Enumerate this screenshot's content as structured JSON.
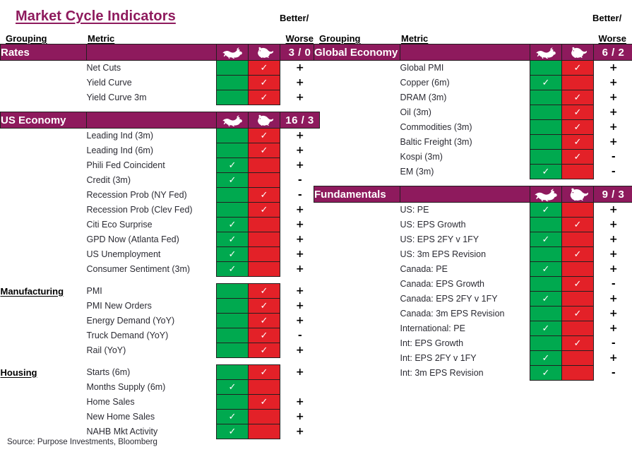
{
  "title": "Market Cycle Indicators",
  "source": "Source: Purpose Investments, Bloomberg",
  "colors": {
    "purple": "#8E1A5D",
    "green": "#00A94F",
    "red": "#E32128",
    "ink": "#231f20"
  },
  "headers": {
    "grouping": "Grouping",
    "metric": "Metric",
    "better": "Better/",
    "worse": "Worse"
  },
  "icons": {
    "bull": "bull-icon",
    "bear": "bear-icon",
    "check": "check-icon"
  },
  "left": {
    "sections": [
      {
        "name": "Rates",
        "score": "3 / 0",
        "has_header": true,
        "rows": [
          {
            "metric": "Net Cuts",
            "bull": "",
            "bear": "✓",
            "trend": "+"
          },
          {
            "metric": "Yield Curve",
            "bull": "",
            "bear": "✓",
            "trend": "+"
          },
          {
            "metric": "Yield Curve 3m",
            "bull": "",
            "bear": "✓",
            "trend": "+"
          }
        ]
      },
      {
        "name": "US Economy",
        "score": "16 / 3",
        "has_header": true,
        "rows": [
          {
            "metric": "Leading Ind (3m)",
            "bull": "",
            "bear": "✓",
            "trend": "+"
          },
          {
            "metric": "Leading Ind (6m)",
            "bull": "",
            "bear": "✓",
            "trend": "+"
          },
          {
            "metric": "Phili Fed Coincident",
            "bull": "✓",
            "bear": "",
            "trend": "+"
          },
          {
            "metric": "Credit (3m)",
            "bull": "✓",
            "bear": "",
            "trend": "-"
          },
          {
            "metric": "Recession Prob (NY Fed)",
            "bull": "",
            "bear": "✓",
            "trend": "-"
          },
          {
            "metric": "Recession Prob (Clev Fed)",
            "bull": "",
            "bear": "✓",
            "trend": "+"
          },
          {
            "metric": "Citi Eco Surprise",
            "bull": "✓",
            "bear": "",
            "trend": "+"
          },
          {
            "metric": "GPD Now (Atlanta Fed)",
            "bull": "✓",
            "bear": "",
            "trend": "+"
          },
          {
            "metric": "US Unemployment",
            "bull": "✓",
            "bear": "",
            "trend": "+"
          },
          {
            "metric": "Consumer Sentiment (3m)",
            "bull": "✓",
            "bear": "",
            "trend": "+"
          }
        ]
      },
      {
        "name": "Manufacturing",
        "score": "",
        "has_header": false,
        "rows": [
          {
            "metric": "PMI",
            "bull": "",
            "bear": "✓",
            "trend": "+"
          },
          {
            "metric": "PMI New Orders",
            "bull": "",
            "bear": "✓",
            "trend": "+"
          },
          {
            "metric": "Energy Demand (YoY)",
            "bull": "",
            "bear": "✓",
            "trend": "+"
          },
          {
            "metric": "Truck Demand (YoY)",
            "bull": "",
            "bear": "✓",
            "trend": "-"
          },
          {
            "metric": "Rail (YoY)",
            "bull": "",
            "bear": "✓",
            "trend": "+"
          }
        ]
      },
      {
        "name": "Housing",
        "score": "",
        "has_header": false,
        "rows": [
          {
            "metric": "Starts (6m)",
            "bull": "",
            "bear": "✓",
            "trend": "+"
          },
          {
            "metric": "Months Supply (6m)",
            "bull": "✓",
            "bear": "",
            "trend": ""
          },
          {
            "metric": "Home Sales",
            "bull": "",
            "bear": "✓",
            "trend": "+"
          },
          {
            "metric": "New Home Sales",
            "bull": "✓",
            "bear": "",
            "trend": "+"
          },
          {
            "metric": "NAHB Mkt Activity",
            "bull": "✓",
            "bear": "",
            "trend": "+"
          }
        ]
      }
    ]
  },
  "right": {
    "sections": [
      {
        "name": "Global Economy",
        "score": "6 / 2",
        "has_header": true,
        "rows": [
          {
            "metric": "Global PMI",
            "bull": "",
            "bear": "✓",
            "trend": "+"
          },
          {
            "metric": "Copper (6m)",
            "bull": "✓",
            "bear": "",
            "trend": "+"
          },
          {
            "metric": "DRAM (3m)",
            "bull": "",
            "bear": "✓",
            "trend": "+"
          },
          {
            "metric": "Oil (3m)",
            "bull": "",
            "bear": "✓",
            "trend": "+"
          },
          {
            "metric": "Commodities (3m)",
            "bull": "",
            "bear": "✓",
            "trend": "+"
          },
          {
            "metric": "Baltic Freight (3m)",
            "bull": "",
            "bear": "✓",
            "trend": "+"
          },
          {
            "metric": "Kospi (3m)",
            "bull": "",
            "bear": "✓",
            "trend": "-"
          },
          {
            "metric": "EM (3m)",
            "bull": "✓",
            "bear": "",
            "trend": "-"
          }
        ]
      },
      {
        "name": "Fundamentals",
        "score": "9 / 3",
        "has_header": true,
        "rows": [
          {
            "metric": "US: PE",
            "bull": "✓",
            "bear": "",
            "trend": "+"
          },
          {
            "metric": "US: EPS Growth",
            "bull": "",
            "bear": "✓",
            "trend": "+"
          },
          {
            "metric": "US: EPS 2FY v 1FY",
            "bull": "✓",
            "bear": "",
            "trend": "+"
          },
          {
            "metric": "US: 3m EPS Revision",
            "bull": "",
            "bear": "✓",
            "trend": "+"
          },
          {
            "metric": "Canada: PE",
            "bull": "✓",
            "bear": "",
            "trend": "+"
          },
          {
            "metric": "Canada: EPS Growth",
            "bull": "",
            "bear": "✓",
            "trend": "-"
          },
          {
            "metric": "Canada: EPS 2FY v 1FY",
            "bull": "✓",
            "bear": "",
            "trend": "+"
          },
          {
            "metric": "Canada: 3m EPS Revision",
            "bull": "",
            "bear": "✓",
            "trend": "+"
          },
          {
            "metric": "International: PE",
            "bull": "✓",
            "bear": "",
            "trend": "+"
          },
          {
            "metric": "Int: EPS Growth",
            "bull": "",
            "bear": "✓",
            "trend": "-"
          },
          {
            "metric": "Int: EPS 2FY v 1FY",
            "bull": "✓",
            "bear": "",
            "trend": "+"
          },
          {
            "metric": "Int: 3m EPS Revision",
            "bull": "✓",
            "bear": "",
            "trend": "-"
          }
        ]
      }
    ]
  }
}
